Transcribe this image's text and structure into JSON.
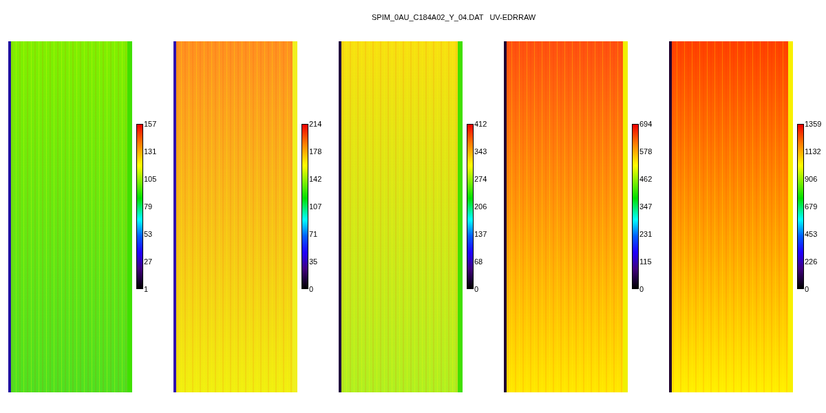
{
  "title": "SPIM_0AU_C184A02_Y_04.DAT   UV-EDRRAW",
  "panels": [
    {
      "ticks": [
        "157",
        "131",
        "105",
        "79",
        "53",
        "27",
        "1"
      ]
    },
    {
      "ticks": [
        "214",
        "178",
        "142",
        "107",
        "71",
        "35",
        "0"
      ]
    },
    {
      "ticks": [
        "412",
        "343",
        "274",
        "206",
        "137",
        "68",
        "0"
      ]
    },
    {
      "ticks": [
        "694",
        "578",
        "462",
        "347",
        "231",
        "115",
        "0"
      ]
    },
    {
      "ticks": [
        "1359",
        "1132",
        "906",
        "679",
        "453",
        "226",
        "0"
      ]
    }
  ]
}
